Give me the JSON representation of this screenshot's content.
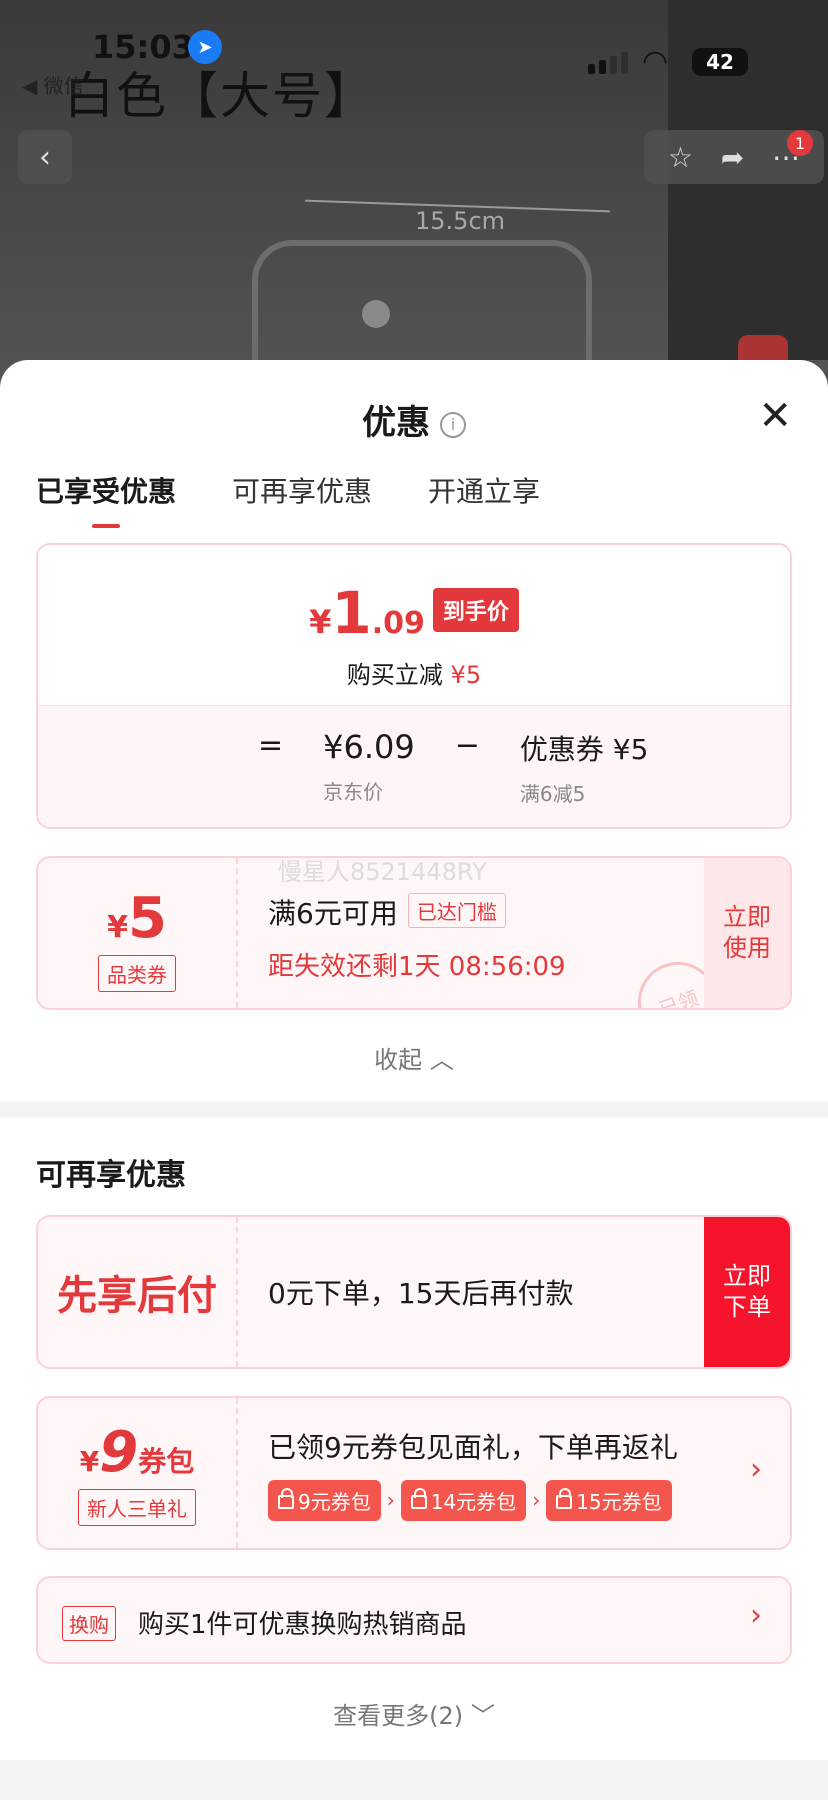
{
  "status_bar": {
    "time": "15:03",
    "back_app": "◀ 微信",
    "battery": "42"
  },
  "background": {
    "title": "白色【大号】",
    "dimension_label": "15.5cm",
    "cart_badge": "1"
  },
  "sheet": {
    "title": "优惠",
    "tabs": [
      "已享受优惠",
      "可再享优惠",
      "开通立享"
    ],
    "price_card": {
      "yen": "¥",
      "big": "1",
      "decimal": ".09",
      "hand_price_label": "到手价",
      "save_text": "购买立减",
      "save_amount": "¥5",
      "equals": "=",
      "minus": "−",
      "jd_price": "¥6.09",
      "jd_price_label": "京东价",
      "coupon_value": "优惠券 ¥5",
      "coupon_rule": "满6减5"
    },
    "coupon": {
      "yen": "¥",
      "amount": "5",
      "type": "品类券",
      "condition": "满6元可用",
      "threshold_tag": "已达门槛",
      "expire": "距失效还剩1天 08:56:09",
      "use_button": "立即使用",
      "watermark": "慢星人8521448RY",
      "stamp": "已领"
    },
    "collapse_label": "收起"
  },
  "more_offers": {
    "section_title": "可再享优惠",
    "pay_later": {
      "title": "先享后付",
      "desc": "0元下单，15天后再付款",
      "button": "立即下单"
    },
    "coupon_package": {
      "yen": "¥",
      "amount": "9",
      "unit": "券包",
      "tag": "新人三单礼",
      "title": "已领9元券包见面礼，下单再返礼",
      "chips": [
        "9元券包",
        "14元券包",
        "15元券包"
      ]
    },
    "exchange": {
      "tag": "换购",
      "text": "购买1件可优惠换购热销商品"
    },
    "see_more": "查看更多(2)"
  },
  "colors": {
    "accent": "#e4393c",
    "button_red": "#f6142d",
    "light_pink": "#fff7f7"
  }
}
